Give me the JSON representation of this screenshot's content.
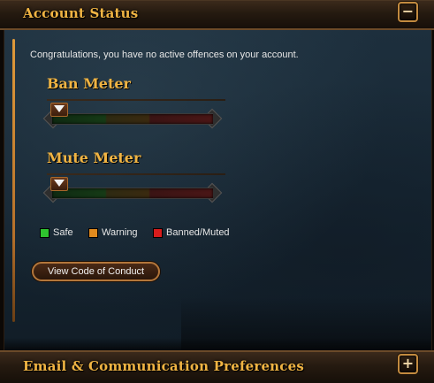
{
  "account_status": {
    "title": "Account Status",
    "collapse_symbol": "−",
    "notice": "Congratulations, you have no active offences on your account.",
    "ban_meter": {
      "title": "Ban Meter",
      "level": 0
    },
    "mute_meter": {
      "title": "Mute Meter",
      "level": 0
    },
    "legend": [
      {
        "label": "Safe",
        "color": "#2fc42f"
      },
      {
        "label": "Warning",
        "color": "#e08a1e"
      },
      {
        "label": "Banned/Muted",
        "color": "#d81c1c"
      }
    ],
    "conduct_button": "View Code of Conduct"
  },
  "email_preferences": {
    "title": "Email & Communication Preferences",
    "expand_symbol": "+"
  },
  "colors": {
    "accent": "#f0b443",
    "frame": "#6b4a29"
  },
  "icons": {
    "collapse": "minus-icon",
    "expand": "plus-icon",
    "meter_pointer": "triangle-down-icon"
  }
}
